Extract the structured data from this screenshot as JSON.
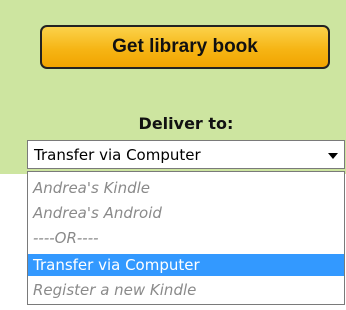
{
  "primary_button": {
    "label": "Get library book"
  },
  "deliver_to": {
    "label": "Deliver to:",
    "selected_value": "Transfer via Computer",
    "options": [
      {
        "label": "Andrea's Kindle",
        "state": "disabled"
      },
      {
        "label": "Andrea's Android",
        "state": "disabled"
      },
      {
        "label": "----OR----",
        "state": "disabled"
      },
      {
        "label": "Transfer via Computer",
        "state": "highlighted"
      },
      {
        "label": "Register a new Kindle",
        "state": "enabled"
      }
    ]
  },
  "colors": {
    "panel_background": "#cde5a0",
    "button_gradient_top": "#fbd24a",
    "button_gradient_bottom": "#f1a400",
    "highlight": "#3399ff",
    "disabled_text": "#8a8a8a"
  }
}
